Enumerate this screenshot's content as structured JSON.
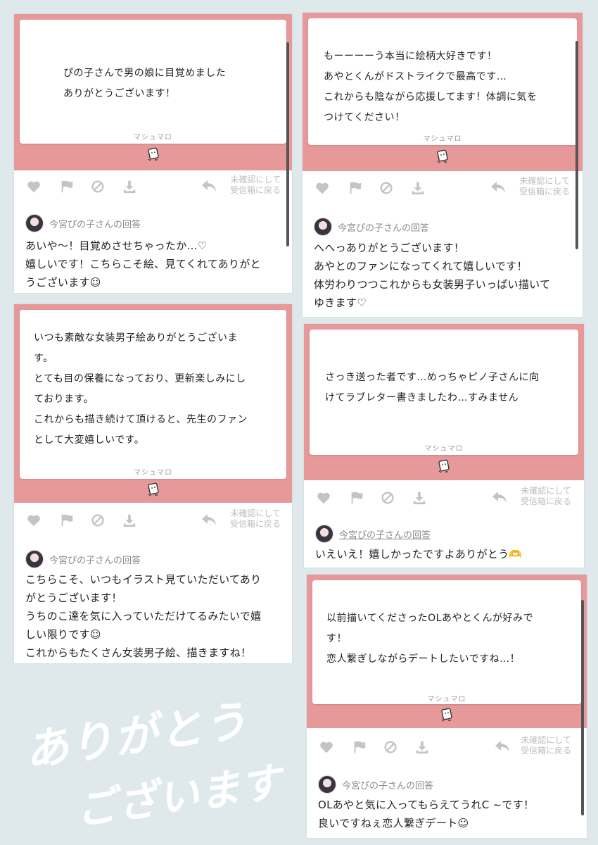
{
  "brand": "マシュマロ",
  "back_label_line1": "未確認にして",
  "back_label_line2": "受信箱に戻る",
  "answerer": "今宮ぴの子さんの回答",
  "handwriting": {
    "line1": "ありがとう",
    "line2": "ございます！"
  },
  "cards": [
    {
      "message": [
        "ぴの子さんで男の娘に目覚めました",
        "ありがとうございます！"
      ],
      "answer": [
        "あいや〜！目覚めさせちゃったか…♡",
        "嬉しいです！こちらこそ絵、見てくれてありがと",
        "うございます☺"
      ]
    },
    {
      "message": [
        "もーーーーう本当に絵柄大好きです！",
        "あやとくんがドストライクで最高です…",
        "これからも陰ながら応援してます！体調に気を",
        "つけてください！"
      ],
      "answer": [
        "へへっありがとうございます！",
        "あやとのファンになってくれて嬉しいです！",
        "体労わりつつこれからも女装男子いっぱい描いて",
        "ゆきます♡"
      ]
    },
    {
      "message": [
        "いつも素敵な女装男子絵ありがとうございま",
        "す。",
        "とても目の保養になっており、更新楽しみにし",
        "ております。",
        "これからも描き続けて頂けると、先生のファン",
        "として大変嬉しいです。"
      ],
      "answer": [
        "こちらこそ、いつもイラスト見ていただいてあり",
        "がとうございます！",
        "うちのこ達を気に入っていただけてるみたいで嬉",
        "しい限りです☺",
        "これからもたくさん女装男子絵、描きますね！"
      ]
    },
    {
      "message": [
        "さっき送った者です…めっちゃピノ子さんに向",
        "けてラブレター書きましたわ…すみません"
      ],
      "answer": [
        "いえいえ！嬉しかったですよありがとう🫶"
      ]
    },
    {
      "message": [
        "以前描いてくださったOLあやとくんが好みで",
        "す！",
        "恋人繋ぎしながらデートしたいですね…！"
      ],
      "answer": [
        "OLあやと気に入ってもらえてうれC ~です！",
        "良いですねぇ恋人繋ぎデート☺"
      ]
    }
  ],
  "colors": {
    "card_accent": "#e7999a",
    "background": "#dfe9ec",
    "icon_gray": "#c4c4c4"
  }
}
